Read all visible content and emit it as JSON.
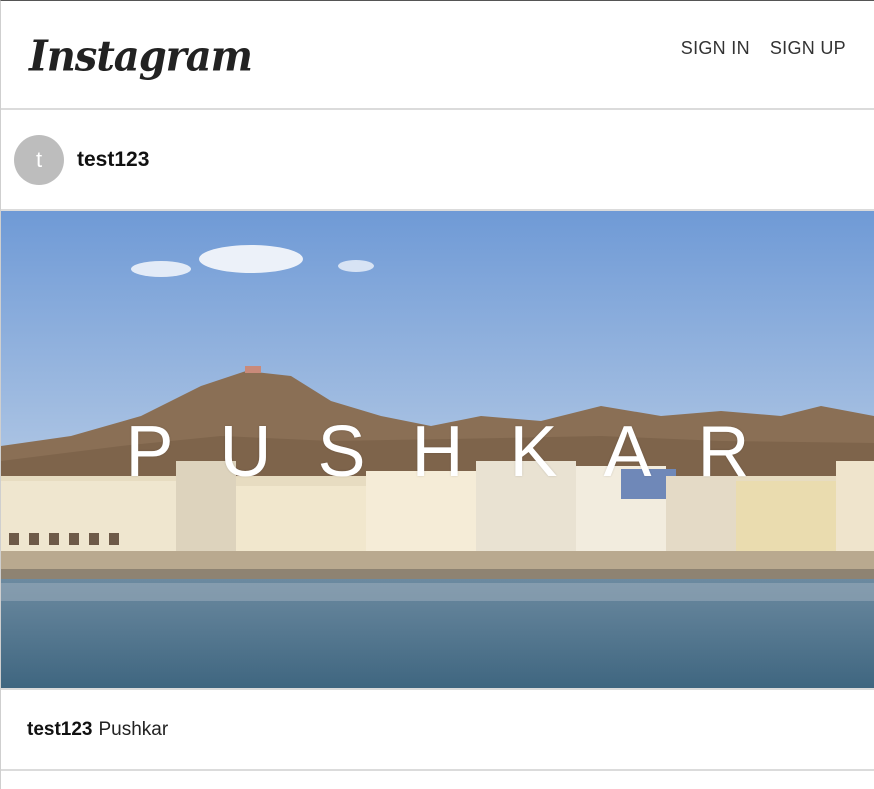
{
  "header": {
    "logo": "Instagram",
    "nav": {
      "sign_in": "SIGN IN",
      "sign_up": "SIGN UP"
    }
  },
  "post": {
    "avatar_initial": "t",
    "username": "test123",
    "image_overlay_text": "PUSHKAR",
    "caption": {
      "username": "test123",
      "text": "Pushkar"
    }
  },
  "colors": {
    "divider": "#dbdbdb",
    "avatar_bg": "#bdbdbd",
    "sky": "#7aa3d8",
    "water": "#4f7591"
  }
}
